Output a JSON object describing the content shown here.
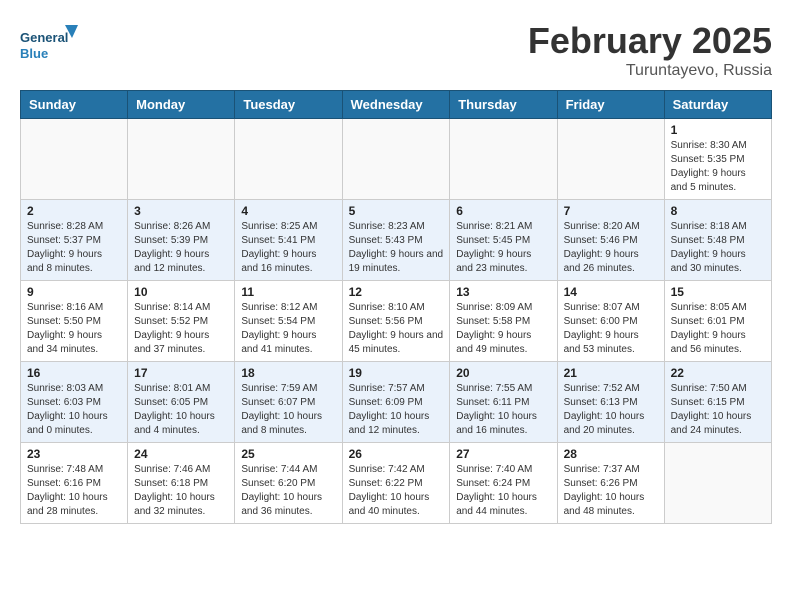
{
  "header": {
    "logo_general": "General",
    "logo_blue": "Blue",
    "month_title": "February 2025",
    "location": "Turuntayevo, Russia"
  },
  "weekdays": [
    "Sunday",
    "Monday",
    "Tuesday",
    "Wednesday",
    "Thursday",
    "Friday",
    "Saturday"
  ],
  "weeks": [
    [
      {
        "day": "",
        "info": ""
      },
      {
        "day": "",
        "info": ""
      },
      {
        "day": "",
        "info": ""
      },
      {
        "day": "",
        "info": ""
      },
      {
        "day": "",
        "info": ""
      },
      {
        "day": "",
        "info": ""
      },
      {
        "day": "1",
        "info": "Sunrise: 8:30 AM\nSunset: 5:35 PM\nDaylight: 9 hours and 5 minutes."
      }
    ],
    [
      {
        "day": "2",
        "info": "Sunrise: 8:28 AM\nSunset: 5:37 PM\nDaylight: 9 hours and 8 minutes."
      },
      {
        "day": "3",
        "info": "Sunrise: 8:26 AM\nSunset: 5:39 PM\nDaylight: 9 hours and 12 minutes."
      },
      {
        "day": "4",
        "info": "Sunrise: 8:25 AM\nSunset: 5:41 PM\nDaylight: 9 hours and 16 minutes."
      },
      {
        "day": "5",
        "info": "Sunrise: 8:23 AM\nSunset: 5:43 PM\nDaylight: 9 hours and 19 minutes."
      },
      {
        "day": "6",
        "info": "Sunrise: 8:21 AM\nSunset: 5:45 PM\nDaylight: 9 hours and 23 minutes."
      },
      {
        "day": "7",
        "info": "Sunrise: 8:20 AM\nSunset: 5:46 PM\nDaylight: 9 hours and 26 minutes."
      },
      {
        "day": "8",
        "info": "Sunrise: 8:18 AM\nSunset: 5:48 PM\nDaylight: 9 hours and 30 minutes."
      }
    ],
    [
      {
        "day": "9",
        "info": "Sunrise: 8:16 AM\nSunset: 5:50 PM\nDaylight: 9 hours and 34 minutes."
      },
      {
        "day": "10",
        "info": "Sunrise: 8:14 AM\nSunset: 5:52 PM\nDaylight: 9 hours and 37 minutes."
      },
      {
        "day": "11",
        "info": "Sunrise: 8:12 AM\nSunset: 5:54 PM\nDaylight: 9 hours and 41 minutes."
      },
      {
        "day": "12",
        "info": "Sunrise: 8:10 AM\nSunset: 5:56 PM\nDaylight: 9 hours and 45 minutes."
      },
      {
        "day": "13",
        "info": "Sunrise: 8:09 AM\nSunset: 5:58 PM\nDaylight: 9 hours and 49 minutes."
      },
      {
        "day": "14",
        "info": "Sunrise: 8:07 AM\nSunset: 6:00 PM\nDaylight: 9 hours and 53 minutes."
      },
      {
        "day": "15",
        "info": "Sunrise: 8:05 AM\nSunset: 6:01 PM\nDaylight: 9 hours and 56 minutes."
      }
    ],
    [
      {
        "day": "16",
        "info": "Sunrise: 8:03 AM\nSunset: 6:03 PM\nDaylight: 10 hours and 0 minutes."
      },
      {
        "day": "17",
        "info": "Sunrise: 8:01 AM\nSunset: 6:05 PM\nDaylight: 10 hours and 4 minutes."
      },
      {
        "day": "18",
        "info": "Sunrise: 7:59 AM\nSunset: 6:07 PM\nDaylight: 10 hours and 8 minutes."
      },
      {
        "day": "19",
        "info": "Sunrise: 7:57 AM\nSunset: 6:09 PM\nDaylight: 10 hours and 12 minutes."
      },
      {
        "day": "20",
        "info": "Sunrise: 7:55 AM\nSunset: 6:11 PM\nDaylight: 10 hours and 16 minutes."
      },
      {
        "day": "21",
        "info": "Sunrise: 7:52 AM\nSunset: 6:13 PM\nDaylight: 10 hours and 20 minutes."
      },
      {
        "day": "22",
        "info": "Sunrise: 7:50 AM\nSunset: 6:15 PM\nDaylight: 10 hours and 24 minutes."
      }
    ],
    [
      {
        "day": "23",
        "info": "Sunrise: 7:48 AM\nSunset: 6:16 PM\nDaylight: 10 hours and 28 minutes."
      },
      {
        "day": "24",
        "info": "Sunrise: 7:46 AM\nSunset: 6:18 PM\nDaylight: 10 hours and 32 minutes."
      },
      {
        "day": "25",
        "info": "Sunrise: 7:44 AM\nSunset: 6:20 PM\nDaylight: 10 hours and 36 minutes."
      },
      {
        "day": "26",
        "info": "Sunrise: 7:42 AM\nSunset: 6:22 PM\nDaylight: 10 hours and 40 minutes."
      },
      {
        "day": "27",
        "info": "Sunrise: 7:40 AM\nSunset: 6:24 PM\nDaylight: 10 hours and 44 minutes."
      },
      {
        "day": "28",
        "info": "Sunrise: 7:37 AM\nSunset: 6:26 PM\nDaylight: 10 hours and 48 minutes."
      },
      {
        "day": "",
        "info": ""
      }
    ]
  ]
}
